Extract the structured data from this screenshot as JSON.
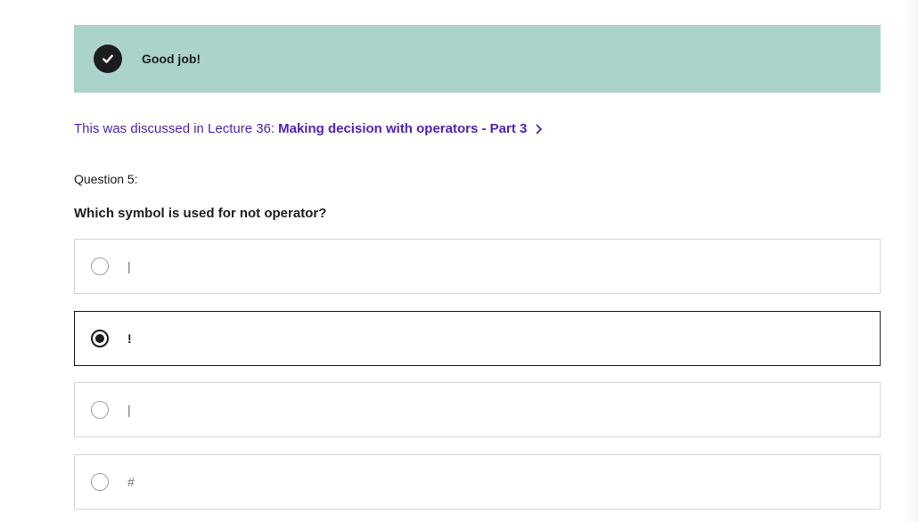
{
  "feedback": {
    "icon": "check-circle-icon",
    "message": "Good job!",
    "background": "#acd2cc"
  },
  "lecture_reference": {
    "prefix": "This was discussed in Lecture 36:",
    "title": "Making decision with operators - Part 3",
    "icon": "chevron-right-icon",
    "color": "#5022c3"
  },
  "question": {
    "number_label": "Question 5:",
    "prompt": "Which symbol is used for not operator?"
  },
  "options": [
    {
      "label": "|",
      "selected": false
    },
    {
      "label": "!",
      "selected": true
    },
    {
      "label": "|",
      "selected": false
    },
    {
      "label": "#",
      "selected": false
    }
  ]
}
